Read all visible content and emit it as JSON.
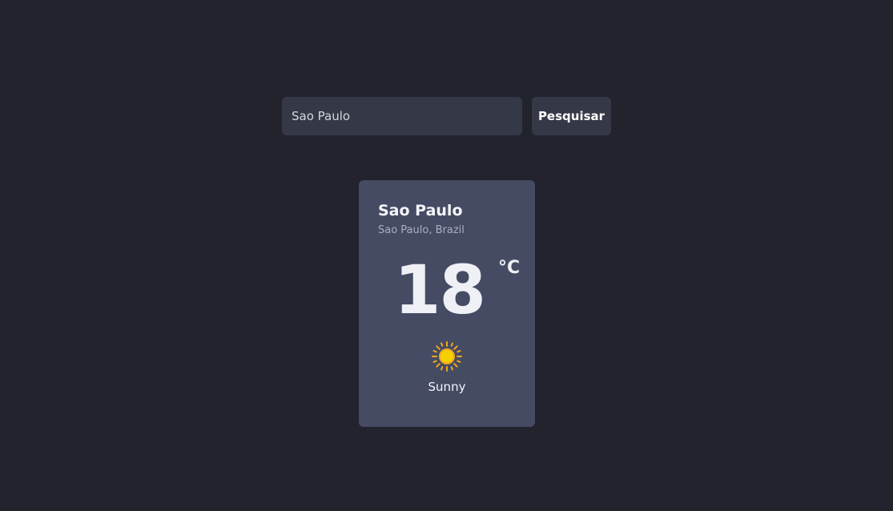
{
  "search": {
    "value": "Sao Paulo",
    "button_label": "Pesquisar"
  },
  "weather": {
    "city": "Sao Paulo",
    "region": "Sao Paulo, Brazil",
    "temperature": "18",
    "unit": "°C",
    "condition": "Sunny",
    "icon": "sun-icon"
  },
  "colors": {
    "background": "#22232c",
    "input": "#353846",
    "card": "#454b63",
    "sun": "#f5c400"
  }
}
